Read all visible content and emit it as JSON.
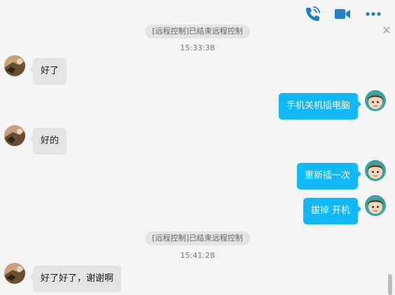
{
  "toolbar": {
    "icons": [
      "phone-call-icon",
      "video-call-icon",
      "more-icon"
    ],
    "accent_color": "#1f7fc8"
  },
  "messages": {
    "system1": {
      "text": "[远程控制]已结束远程控制",
      "time": "15:33:38"
    },
    "m1": {
      "side": "left",
      "text": "好了"
    },
    "m2": {
      "side": "right",
      "text": "手机关机插电脑"
    },
    "m3": {
      "side": "left",
      "text": "好的"
    },
    "m4": {
      "side": "right",
      "text": "重新插一次"
    },
    "m5": {
      "side": "right",
      "text": "拔掉 开机"
    },
    "system2": {
      "text": "[远程控制]已结束远程控制",
      "time": "15:41:28"
    },
    "m6": {
      "side": "left",
      "text": "好了好了，谢谢啊"
    }
  },
  "colors": {
    "self_bubble": "#12b7f5",
    "other_bubble": "#e3e3e3",
    "background": "#f5f5f5"
  }
}
